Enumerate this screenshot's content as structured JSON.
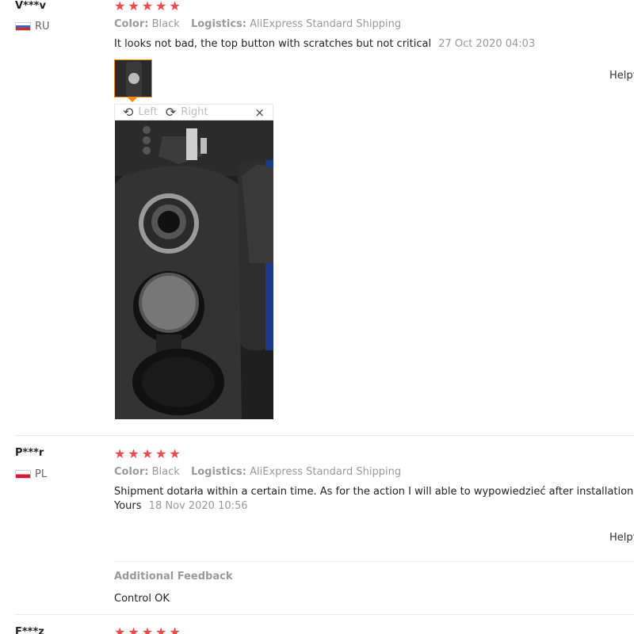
{
  "reviews": [
    {
      "user": "V***v",
      "country": "RU",
      "stars": 5,
      "color_label": "Color:",
      "color_value": "Black",
      "logistics_label": "Logistics:",
      "logistics_value": "AliExpress Standard Shipping",
      "text": "It looks not bad, the top button with scratches but not critical",
      "date": "27 Oct 2020 04:03",
      "helpful": "Helpf",
      "viewer": {
        "left_label": "Left",
        "right_label": "Right",
        "close": "×"
      }
    },
    {
      "user": "P***r",
      "country": "PL",
      "stars": 5,
      "color_label": "Color:",
      "color_value": "Black",
      "logistics_label": "Logistics:",
      "logistics_value": "AliExpress Standard Shipping",
      "text_line1": "Shipment dotarła within a certain time. As for the action I will able to wypowiedzieć after installation of the m",
      "text_line2": "Yours",
      "date": "18 Nov 2020 10:56",
      "helpful": "Helpf",
      "additional_title": "Additional Feedback",
      "additional_text": "Control OK"
    },
    {
      "user": "F***z",
      "stars": 5
    }
  ],
  "icons": {
    "star": "★",
    "rotate_left": "⟲",
    "rotate_right": "⟳"
  },
  "colors": {
    "star": "#f04848",
    "thumb_border": "#ff8a00"
  }
}
